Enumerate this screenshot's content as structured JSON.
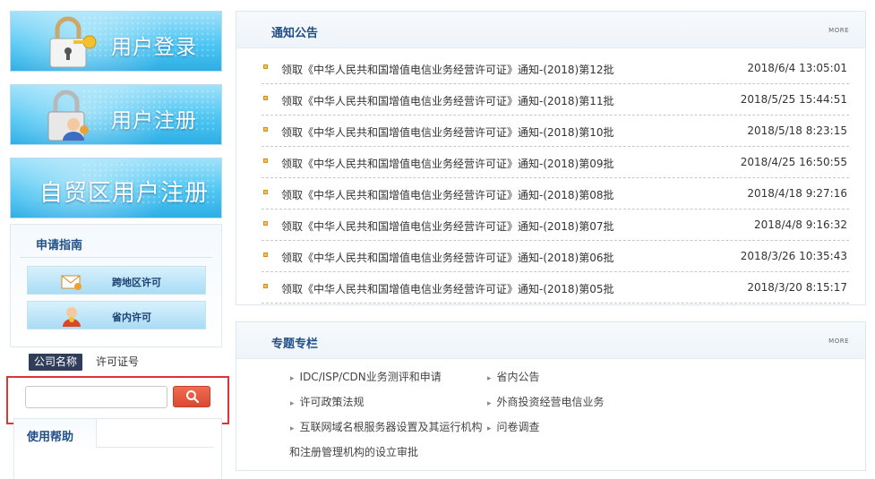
{
  "sidebar": {
    "login_label": "用户登录",
    "register_label": "用户注册",
    "ftz_register_label": "自贸区用户注册",
    "guide": {
      "title": "申请指南",
      "items": [
        {
          "label": "跨地区许可"
        },
        {
          "label": "省内许可"
        }
      ]
    },
    "search": {
      "tab_company": "公司名称",
      "tab_license": "许可证号",
      "input_value": "",
      "input_placeholder": ""
    },
    "help": {
      "title": "使用帮助"
    }
  },
  "notice": {
    "title": "通知公告",
    "more_label": "MORE",
    "items": [
      {
        "text": "领取《中华人民共和国增值电信业务经营许可证》通知-(2018)第12批",
        "date": "2018/6/4 13:05:01"
      },
      {
        "text": "领取《中华人民共和国增值电信业务经营许可证》通知-(2018)第11批",
        "date": "2018/5/25 15:44:51"
      },
      {
        "text": "领取《中华人民共和国增值电信业务经营许可证》通知-(2018)第10批",
        "date": "2018/5/18 8:23:15"
      },
      {
        "text": "领取《中华人民共和国增值电信业务经营许可证》通知-(2018)第09批",
        "date": "2018/4/25 16:50:55"
      },
      {
        "text": "领取《中华人民共和国增值电信业务经营许可证》通知-(2018)第08批",
        "date": "2018/4/18 9:27:16"
      },
      {
        "text": "领取《中华人民共和国增值电信业务经营许可证》通知-(2018)第07批",
        "date": "2018/4/8 9:16:32"
      },
      {
        "text": "领取《中华人民共和国增值电信业务经营许可证》通知-(2018)第06批",
        "date": "2018/3/26 10:35:43"
      },
      {
        "text": "领取《中华人民共和国增值电信业务经营许可证》通知-(2018)第05批",
        "date": "2018/3/20 8:15:17"
      }
    ]
  },
  "special": {
    "title": "专题专栏",
    "more_label": "MORE",
    "left_items": [
      {
        "text": "IDC/ISP/CDN业务测评和申请"
      },
      {
        "text": "许可政策法规"
      },
      {
        "text": "互联网域名根服务器设置及其运行机构"
      }
    ],
    "left_continuation": "和注册管理机构的设立审批",
    "right_items": [
      {
        "text": "省内公告"
      },
      {
        "text": "外商投资经营电信业务"
      },
      {
        "text": "问卷调查"
      }
    ],
    "arrow": "▸"
  },
  "colors": {
    "accent": "#1f4f86",
    "banner": "#4ec6f2",
    "highlight_box": "#d9363a",
    "search_button": "#e05a3f",
    "tab_active": "#2f3c5a"
  }
}
